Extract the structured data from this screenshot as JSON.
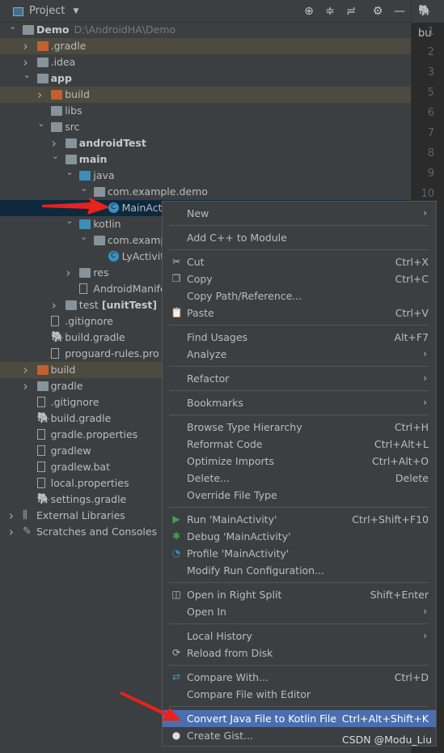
{
  "header": {
    "title": "Project",
    "icons": [
      "locate-icon",
      "expand-all-icon",
      "collapse-all-icon",
      "gear-icon",
      "minimize-icon"
    ]
  },
  "editor": {
    "tab": "bu",
    "line_numbers": [
      "1",
      "2",
      "3",
      "5",
      "6",
      "7",
      "8",
      "9",
      "10"
    ]
  },
  "tree": [
    {
      "label": "Demo",
      "path": "D:\\AndroidHA\\Demo",
      "level": 0,
      "chev": "v",
      "icon": "module",
      "bold": true
    },
    {
      "label": ".gradle",
      "level": 1,
      "chev": ">",
      "icon": "folder-orange",
      "excluded": true
    },
    {
      "label": ".idea",
      "level": 1,
      "chev": ">",
      "icon": "folder"
    },
    {
      "label": "app",
      "level": 1,
      "chev": "v",
      "icon": "module-folder",
      "bold": true
    },
    {
      "label": "build",
      "level": 2,
      "chev": ">",
      "icon": "folder-orange",
      "excluded": true
    },
    {
      "label": "libs",
      "level": 2,
      "icon": "folder"
    },
    {
      "label": "src",
      "level": 2,
      "chev": "v",
      "icon": "folder"
    },
    {
      "label": "androidTest",
      "level": 3,
      "chev": ">",
      "icon": "module-folder",
      "bold": true
    },
    {
      "label": "main",
      "level": 3,
      "chev": "v",
      "icon": "module-folder",
      "bold": true
    },
    {
      "label": "java",
      "level": 4,
      "chev": "v",
      "icon": "folder-blue"
    },
    {
      "label": "com.example.demo",
      "level": 5,
      "chev": "v",
      "icon": "package"
    },
    {
      "label": "MainActivity",
      "level": 6,
      "icon": "class",
      "selected": true
    },
    {
      "label": "kotlin",
      "level": 4,
      "chev": "v",
      "icon": "folder-blue"
    },
    {
      "label": "com.example.demo",
      "level": 5,
      "chev": "v",
      "icon": "package"
    },
    {
      "label": "LyActivity",
      "level": 6,
      "icon": "kotlin-class"
    },
    {
      "label": "res",
      "level": 4,
      "chev": ">",
      "icon": "res-folder"
    },
    {
      "label": "AndroidManifest.xml",
      "level": 4,
      "icon": "manifest"
    },
    {
      "label": "test",
      "suffix": "[unitTest]",
      "level": 3,
      "chev": ">",
      "icon": "test-folder"
    },
    {
      "label": ".gitignore",
      "level": 2,
      "icon": "file"
    },
    {
      "label": "build.gradle",
      "level": 2,
      "icon": "gradle"
    },
    {
      "label": "proguard-rules.pro",
      "level": 2,
      "icon": "file"
    },
    {
      "label": "build",
      "level": 1,
      "chev": ">",
      "icon": "folder-orange",
      "excluded": true
    },
    {
      "label": "gradle",
      "level": 1,
      "chev": ">",
      "icon": "folder"
    },
    {
      "label": ".gitignore",
      "level": 1,
      "icon": "file"
    },
    {
      "label": "build.gradle",
      "level": 1,
      "icon": "gradle"
    },
    {
      "label": "gradle.properties",
      "level": 1,
      "icon": "properties"
    },
    {
      "label": "gradlew",
      "level": 1,
      "icon": "script"
    },
    {
      "label": "gradlew.bat",
      "level": 1,
      "icon": "file"
    },
    {
      "label": "local.properties",
      "level": 1,
      "icon": "properties"
    },
    {
      "label": "settings.gradle",
      "level": 1,
      "icon": "gradle"
    },
    {
      "label": "External Libraries",
      "level": 0,
      "chev": ">",
      "icon": "libraries"
    },
    {
      "label": "Scratches and Consoles",
      "level": 0,
      "chev": ">",
      "icon": "scratches"
    }
  ],
  "menu": [
    {
      "label": "New",
      "submenu": true
    },
    {
      "sep": true
    },
    {
      "label": "Add C++ to Module"
    },
    {
      "sep": true
    },
    {
      "label": "Cut",
      "shortcut": "Ctrl+X",
      "icon": "scissors-icon"
    },
    {
      "label": "Copy",
      "shortcut": "Ctrl+C",
      "icon": "copy-icon"
    },
    {
      "label": "Copy Path/Reference..."
    },
    {
      "label": "Paste",
      "shortcut": "Ctrl+V",
      "icon": "paste-icon"
    },
    {
      "sep": true
    },
    {
      "label": "Find Usages",
      "shortcut": "Alt+F7"
    },
    {
      "label": "Analyze",
      "submenu": true
    },
    {
      "sep": true
    },
    {
      "label": "Refactor",
      "submenu": true
    },
    {
      "sep": true
    },
    {
      "label": "Bookmarks",
      "submenu": true
    },
    {
      "sep": true
    },
    {
      "label": "Browse Type Hierarchy",
      "shortcut": "Ctrl+H"
    },
    {
      "label": "Reformat Code",
      "shortcut": "Ctrl+Alt+L"
    },
    {
      "label": "Optimize Imports",
      "shortcut": "Ctrl+Alt+O"
    },
    {
      "label": "Delete...",
      "shortcut": "Delete"
    },
    {
      "label": "Override File Type"
    },
    {
      "sep": true
    },
    {
      "label": "Run 'MainActivity'",
      "shortcut": "Ctrl+Shift+F10",
      "icon": "run-icon"
    },
    {
      "label": "Debug 'MainActivity'",
      "icon": "debug-icon"
    },
    {
      "label": "Profile 'MainActivity'",
      "icon": "profile-icon"
    },
    {
      "label": "Modify Run Configuration..."
    },
    {
      "sep": true
    },
    {
      "label": "Open in Right Split",
      "shortcut": "Shift+Enter",
      "icon": "split-icon"
    },
    {
      "label": "Open In",
      "submenu": true
    },
    {
      "sep": true
    },
    {
      "label": "Local History",
      "submenu": true
    },
    {
      "label": "Reload from Disk",
      "icon": "reload-icon"
    },
    {
      "sep": true
    },
    {
      "label": "Compare With...",
      "shortcut": "Ctrl+D",
      "icon": "compare-icon"
    },
    {
      "label": "Compare File with Editor"
    },
    {
      "sep": true
    },
    {
      "label": "Convert Java File to Kotlin File",
      "shortcut": "Ctrl+Alt+Shift+K",
      "highlighted": true
    },
    {
      "label": "Create Gist...",
      "icon": "github-icon"
    }
  ],
  "watermark": "CSDN @Modu_Liu",
  "colors": {
    "selection": "#0d293e",
    "menu_highlight": "#4b6eaf",
    "annotation_arrow": "#e8231c"
  }
}
